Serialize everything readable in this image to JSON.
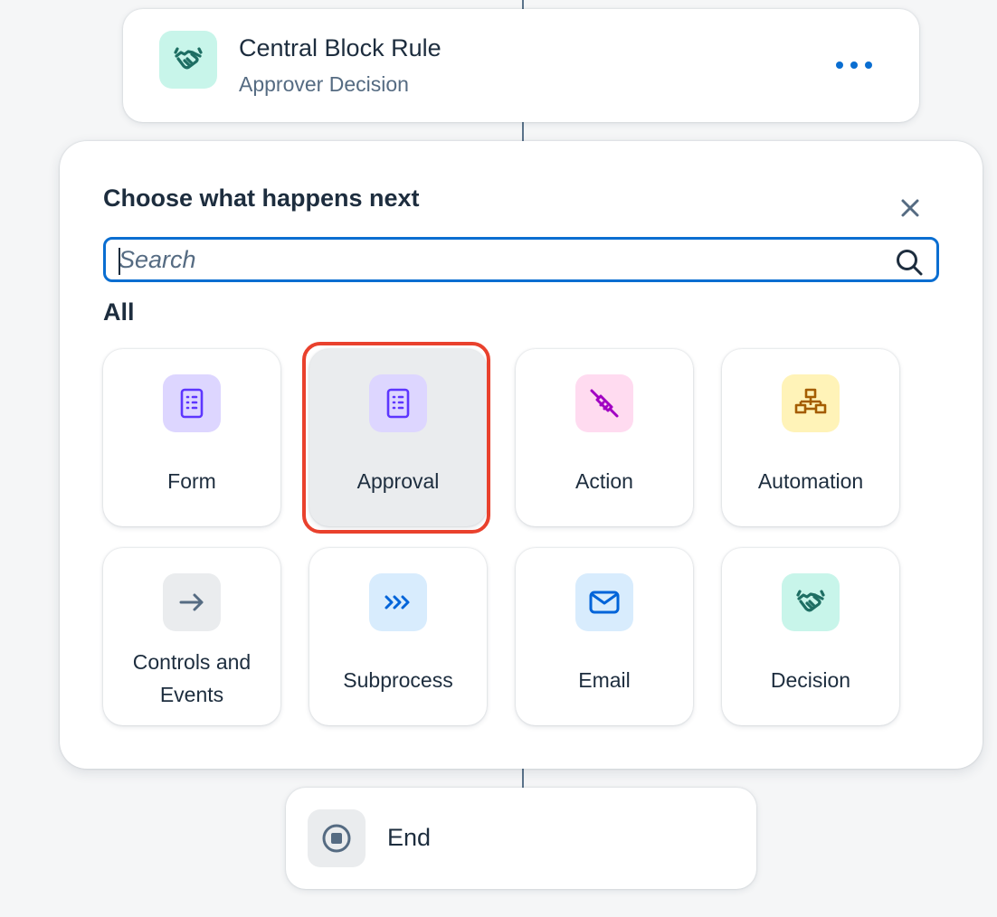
{
  "rule_node": {
    "title": "Central Block Rule",
    "subtitle": "Approver Decision",
    "icon": "decision-icon",
    "more_icon": "more-icon"
  },
  "panel": {
    "title": "Choose what happens next",
    "close_icon": "close-icon",
    "search": {
      "value": "",
      "placeholder": "Search",
      "icon": "search-icon"
    },
    "section_label": "All",
    "tiles": [
      {
        "label": "Form",
        "icon": "form-icon",
        "icon_bg": "#ddd6ff",
        "icon_color": "#5d36ff",
        "selected": false
      },
      {
        "label": "Approval",
        "icon": "approval-icon",
        "icon_bg": "#ddd6ff",
        "icon_color": "#5d36ff",
        "selected": true
      },
      {
        "label": "Action",
        "icon": "plug-icon",
        "icon_bg": "#ffdbf0",
        "icon_color": "#a100c2",
        "selected": false
      },
      {
        "label": "Automation",
        "icon": "org-chart-icon",
        "icon_bg": "#fff3b8",
        "icon_color": "#a45d00",
        "selected": false
      },
      {
        "label": "Controls and Events",
        "icon": "arrow-right-icon",
        "icon_bg": "#eaecee",
        "icon_color": "#556b82",
        "selected": false
      },
      {
        "label": "Subprocess",
        "icon": "chevrons-icon",
        "icon_bg": "#d8ecfd",
        "icon_color": "#0064d9",
        "selected": false
      },
      {
        "label": "Email",
        "icon": "email-icon",
        "icon_bg": "#d8ecfd",
        "icon_color": "#0064d9",
        "selected": false
      },
      {
        "label": "Decision",
        "icon": "decision-icon",
        "icon_bg": "#c8f5ea",
        "icon_color": "#1e6e63",
        "selected": false
      }
    ]
  },
  "end_node": {
    "label": "End",
    "icon": "stop-icon"
  },
  "colors": {
    "accent": "#0a6ed1",
    "selection_ring": "#e9412d",
    "connector": "#5b738b"
  }
}
